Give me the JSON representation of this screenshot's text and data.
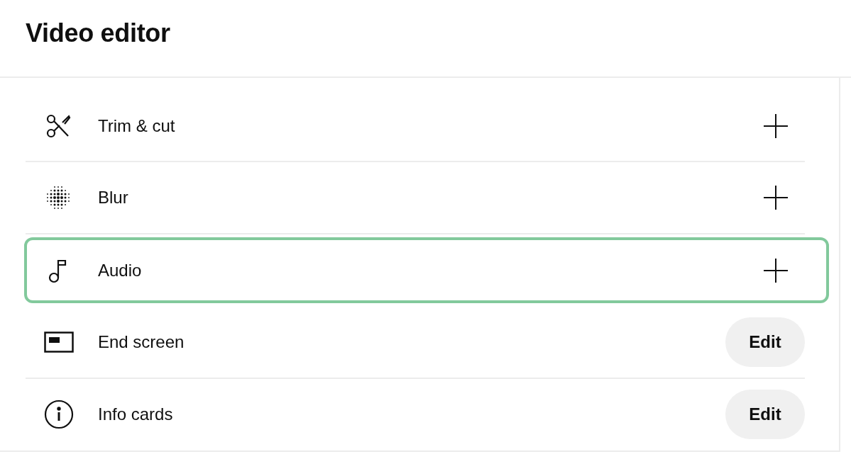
{
  "title": "Video editor",
  "tools": [
    {
      "kind": "trim",
      "label": "Trim & cut",
      "button": {
        "kind": "add"
      },
      "selected": false
    },
    {
      "kind": "blur",
      "label": "Blur",
      "button": {
        "kind": "add"
      },
      "selected": false
    },
    {
      "kind": "audio",
      "label": "Audio",
      "button": {
        "kind": "add"
      },
      "selected": true
    },
    {
      "kind": "endscreen",
      "label": "End screen",
      "button": {
        "kind": "edit",
        "label": "Edit"
      },
      "selected": false
    },
    {
      "kind": "info",
      "label": "Info cards",
      "button": {
        "kind": "edit",
        "label": "Edit"
      },
      "selected": false
    }
  ]
}
